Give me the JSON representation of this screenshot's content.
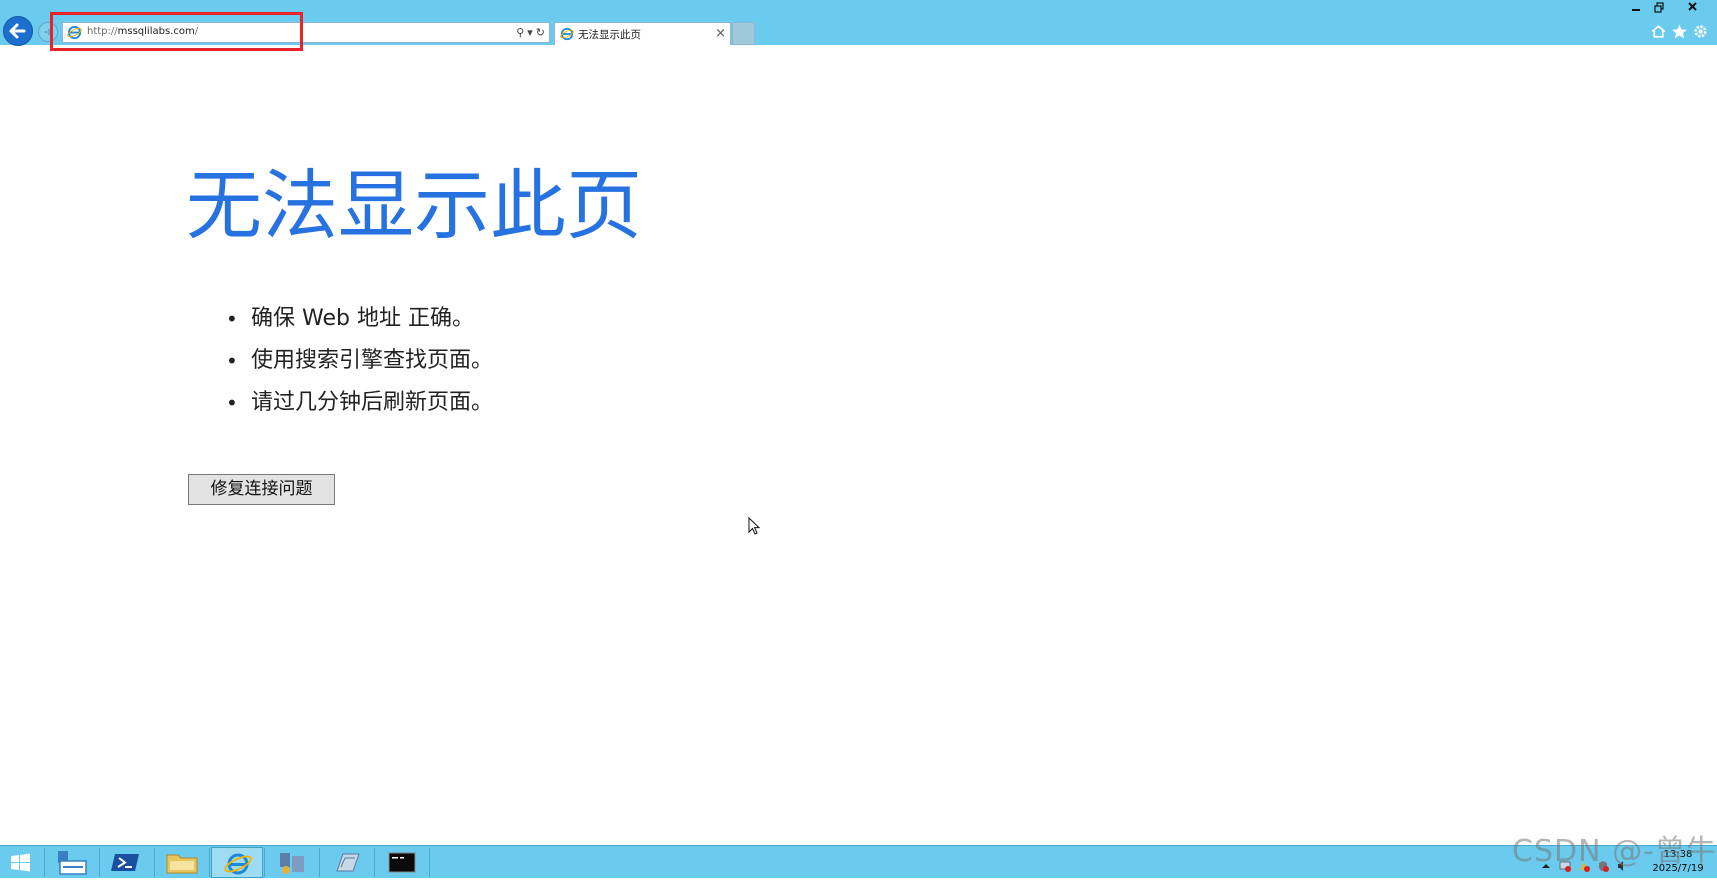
{
  "browser": {
    "address_bar": {
      "url_prefix": "http://",
      "url_host": "mssqlilabs.com",
      "url_suffix": "/"
    },
    "tab": {
      "title": "无法显示此页",
      "close_glyph": "×"
    },
    "address_tools": {
      "search_glyph": "⚲",
      "dropdown_glyph": "▾",
      "refresh_glyph": "↻"
    }
  },
  "page": {
    "title": "无法显示此页",
    "suggestions": [
      "确保 Web 地址 正确。",
      "使用搜索引擎查找页面。",
      "请过几分钟后刷新页面。"
    ],
    "fix_button_label": "修复连接问题"
  },
  "taskbar": {
    "items": [
      "start-icon",
      "server-manager-icon",
      "powershell-icon",
      "file-explorer-icon",
      "internet-explorer-icon",
      "network-tool-icon",
      "editor-icon",
      "command-prompt-icon"
    ],
    "clock": {
      "time": "13:38",
      "date": "2025/7/19"
    }
  },
  "watermark": "CSDN @-曾牛",
  "colors": {
    "toolbar_bg": "#6acbee",
    "title_blue": "#2672e0",
    "highlight_red": "#e8232a",
    "taskbar_bg": "#6acbee"
  }
}
